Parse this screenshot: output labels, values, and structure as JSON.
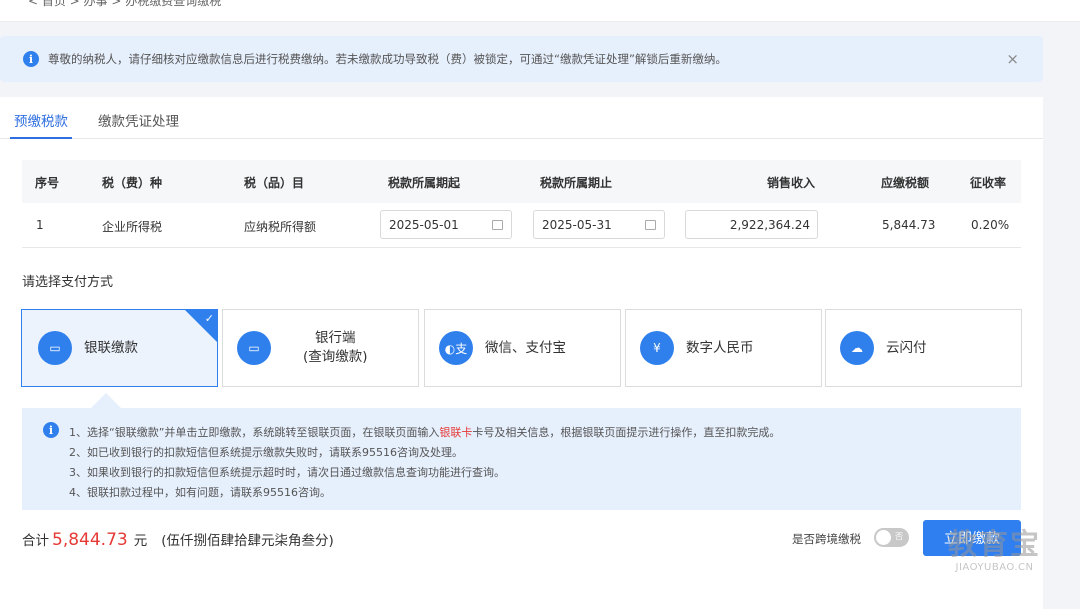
{
  "breadcrumb": "< 首页 > 办事 > 办税缴费查询缴税",
  "notice": {
    "text": "尊敬的纳税人，请仔细核对应缴款信息后进行税费缴纳。若未缴款成功导致税（费）被锁定，可通过“缴款凭证处理”解锁后重新缴纳。",
    "close": "×"
  },
  "tabs": [
    "预缴税款",
    "缴款凭证处理"
  ],
  "table": {
    "headers": [
      "序号",
      "税（费）种",
      "税（品）目",
      "税款所属期起",
      "税款所属期止",
      "销售收入",
      "应缴税额",
      "征收率"
    ],
    "rows": [
      {
        "index": "1",
        "tax_type": "企业所得税",
        "tax_item": "应纳税所得额",
        "period_start": "2025-05-01",
        "period_end": "2025-05-31",
        "sales_income": "2,922,364.24",
        "tax_due": "5,844.73",
        "rate": "0.20%"
      }
    ]
  },
  "payment": {
    "title": "请选择支付方式",
    "options": [
      {
        "label": "银联缴款",
        "icon": "card-icon",
        "selected": true
      },
      {
        "label": "银行端\n(查询缴款)",
        "icon": "bank-terminal-icon",
        "selected": false
      },
      {
        "label": "微信、支付宝",
        "icon": "wechat-alipay-icon",
        "selected": false
      },
      {
        "label": "数字人民币",
        "icon": "digital-rmb-icon",
        "selected": false
      },
      {
        "label": "云闪付",
        "icon": "cloud-pay-icon",
        "selected": false
      }
    ]
  },
  "tips": {
    "line1_a": "1、选择“银联缴款”并单击立即缴款，系统跳转至银联页面，在银联页面输入",
    "line1_red": "银联卡",
    "line1_b": "卡号及相关信息，根据银联页面提示进行操作，直至扣款完成。",
    "line2": "2、如已收到银行的扣款短信但系统提示缴款失败时，请联系95516咨询及处理。",
    "line3": "3、如果收到银行的扣款短信但系统提示超时时，请次日通过缴款信息查询功能进行查询。",
    "line4": "4、银联扣款过程中，如有问题，请联系95516咨询。"
  },
  "footer": {
    "total_label": "合计",
    "total_amount": "5,844.73",
    "unit": "元",
    "amount_words": "(伍仟捌佰肆拾肆元柒角叁分)",
    "cross_border_label": "是否跨境缴税",
    "toggle_text": "否",
    "pay_button": "立即缴款"
  },
  "watermark": {
    "main": "教育宝",
    "sub": "JIAOYUBAO.CN"
  },
  "colors": {
    "accent": "#2f80ed",
    "amount": "#e53935",
    "notice_bg": "#e6effc"
  }
}
